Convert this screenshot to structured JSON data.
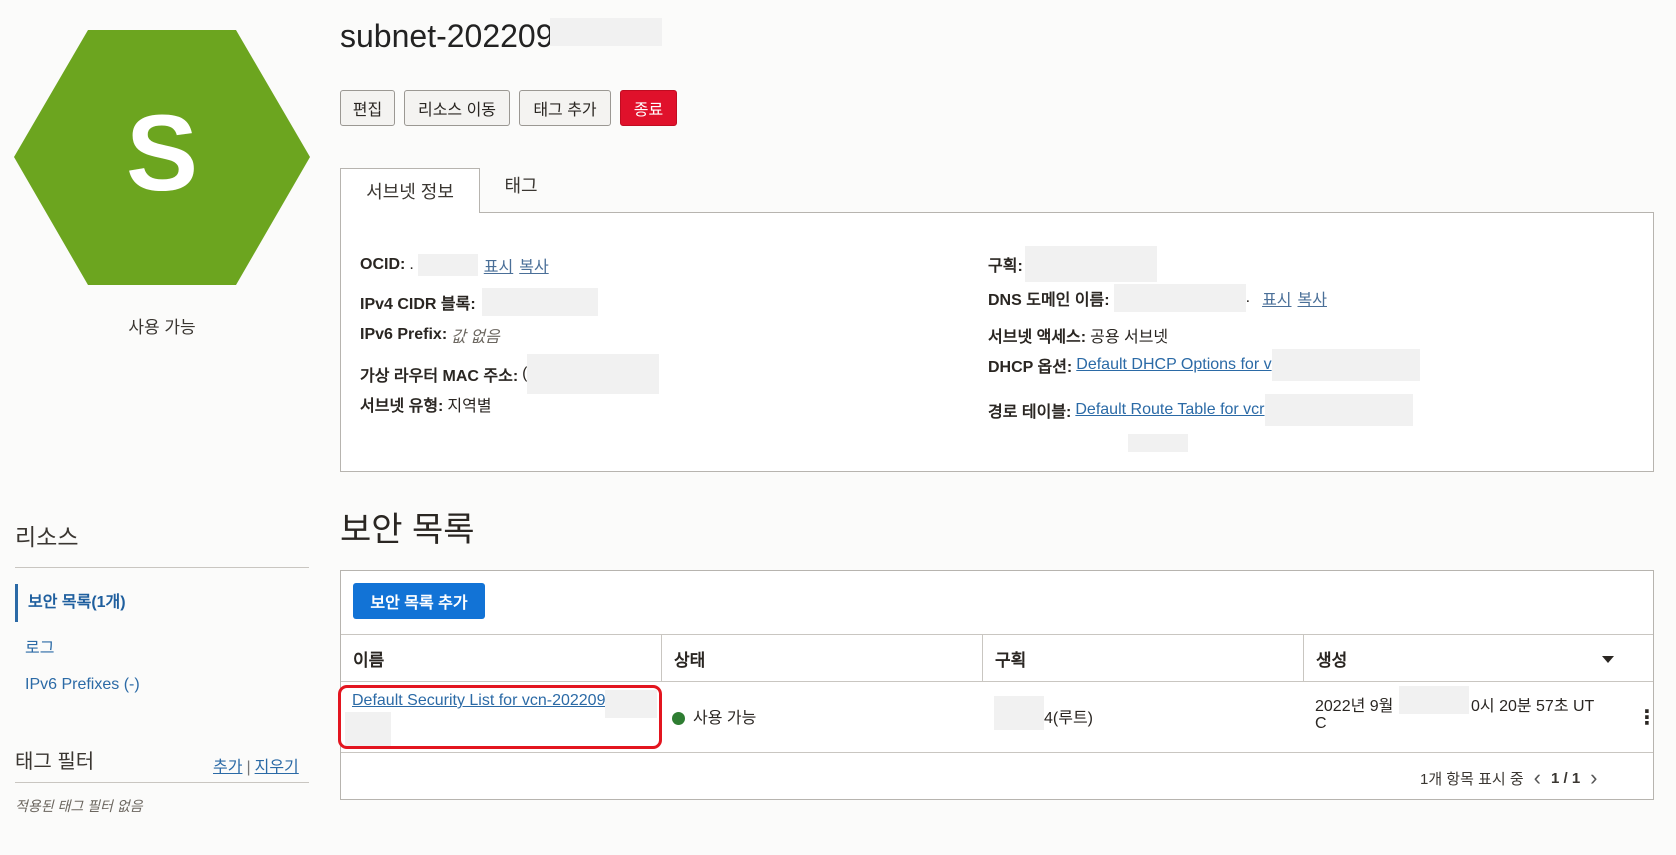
{
  "resource": {
    "icon_letter": "S",
    "icon_color": "#6ca51f",
    "status": "사용 가능",
    "title": "subnet-202209"
  },
  "actions": {
    "edit": "편집",
    "move": "리소스 이동",
    "add_tag": "태그 추가",
    "terminate": "종료"
  },
  "tabs": {
    "info": "서브넷 정보",
    "tags": "태그"
  },
  "info": {
    "ocid_label": "OCID:",
    "ocid_value": ".",
    "show": "표시",
    "copy": "복사",
    "ipv4_label": "IPv4 CIDR 블록:",
    "ipv6_label": "IPv6 Prefix:",
    "ipv6_value": "값 없음",
    "vrouter_label": "가상 라우터 MAC 주소:",
    "vrouter_value": "(",
    "subnet_type_label": "서브넷 유형:",
    "subnet_type_value": "지역별",
    "compartment_label": "구획:",
    "dns_label": "DNS 도메인 이름:",
    "dns_value": ".",
    "access_label": "서브넷 액세스:",
    "access_value": "공용 서브넷",
    "dhcp_label": "DHCP 옵션:",
    "dhcp_link": "Default DHCP Options for v",
    "route_label": "경로 테이블:",
    "route_link": "Default Route Table for vcr"
  },
  "sidebar": {
    "title": "리소스",
    "items": [
      {
        "label": "보안 목록(1개)"
      },
      {
        "label": "로그"
      },
      {
        "label": "IPv6 Prefixes (-)"
      }
    ],
    "tag_filter_title": "태그 필터",
    "tag_add": "추가",
    "tag_sep": "|",
    "tag_clear": "지우기",
    "tag_none": "적용된 태그 필터 없음"
  },
  "security": {
    "title": "보안 목록",
    "add_button": "보안 목록 추가",
    "columns": [
      "이름",
      "상태",
      "구획",
      "생성"
    ],
    "rows": [
      {
        "name": "Default Security List for vcn-202209",
        "status": "사용 가능",
        "compartment": "4(루트)",
        "created_a": "2022년 9월",
        "created_b": "0시 20분 57초 UT",
        "created_c": "C"
      }
    ],
    "footer_count": "1개 항목 표시 중",
    "footer_page": "1 / 1"
  }
}
